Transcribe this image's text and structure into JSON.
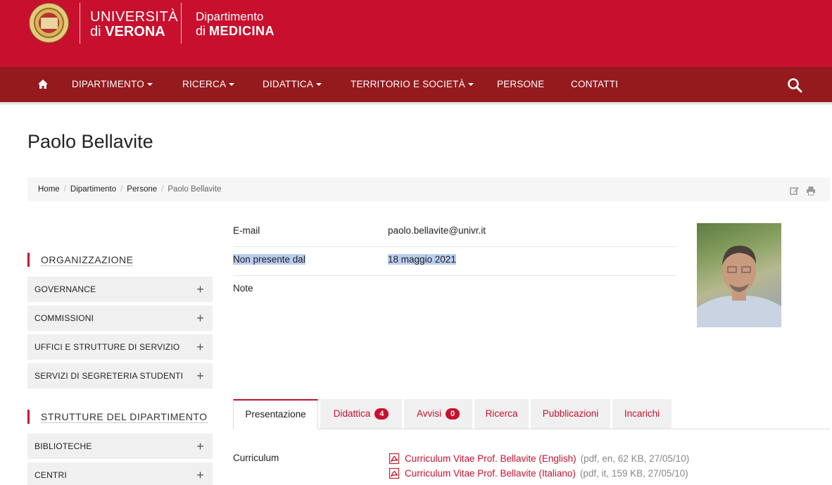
{
  "header": {
    "university_line1": "UNIVERSITÀ",
    "university_line2_prefix": "di",
    "university_line2_bold": "VERONA",
    "department_line1": "Dipartimento",
    "department_line2_prefix": "di",
    "department_line2_bold": "MEDICINA"
  },
  "nav": {
    "items": [
      {
        "label": "DIPARTIMENTO",
        "dropdown": true
      },
      {
        "label": "RICERCA",
        "dropdown": true
      },
      {
        "label": "DIDATTICA",
        "dropdown": true
      },
      {
        "label": "TERRITORIO E SOCIETÀ",
        "dropdown": true
      },
      {
        "label": "PERSONE",
        "dropdown": false
      },
      {
        "label": "CONTATTI",
        "dropdown": false
      }
    ]
  },
  "page": {
    "title": "Paolo Bellavite"
  },
  "breadcrumb": [
    "Home",
    "Dipartimento",
    "Persone",
    "Paolo Bellavite"
  ],
  "sidebar": {
    "sections": [
      {
        "heading": "ORGANIZZAZIONE",
        "items": [
          "GOVERNANCE",
          "COMMISSIONI",
          "UFFICI E STRUTTURE DI SERVIZIO",
          "SERVIZI DI SEGRETERIA STUDENTI"
        ]
      },
      {
        "heading": "STRUTTURE DEL DIPARTIMENTO",
        "items": [
          "BIBLIOTECHE",
          "CENTRI"
        ]
      }
    ]
  },
  "info": {
    "rows": [
      {
        "label": "E-mail",
        "value": "paolo.bellavite@univr.it"
      },
      {
        "label": "Non presente dal",
        "value": "18 maggio 2021"
      },
      {
        "label": "Note",
        "value": ""
      }
    ]
  },
  "tabs": [
    {
      "label": "Presentazione",
      "badge": ""
    },
    {
      "label": "Didattica",
      "badge": "4"
    },
    {
      "label": "Avvisi",
      "badge": "0"
    },
    {
      "label": "Ricerca",
      "badge": ""
    },
    {
      "label": "Pubblicazioni",
      "badge": ""
    },
    {
      "label": "Incarichi",
      "badge": ""
    }
  ],
  "curriculum": {
    "label": "Curriculum",
    "files": [
      {
        "title": "Curriculum Vitae Prof. Bellavite (English)",
        "meta": "(pdf, en, 62 KB, 27/05/10)"
      },
      {
        "title": "Curriculum Vitae Prof. Bellavite (Italiano)",
        "meta": "(pdf, it, 159 KB, 27/05/10)"
      }
    ]
  },
  "colors": {
    "header_red": "#c8102e",
    "nav_dark_red": "#951a1e",
    "link_red": "#c8102e",
    "selection_blue": "#b9cdee"
  },
  "icons": {
    "home": "home-icon",
    "search": "search-icon",
    "edit": "edit-icon",
    "print": "print-icon",
    "plus": "plus-icon",
    "pdf": "pdf-icon"
  }
}
